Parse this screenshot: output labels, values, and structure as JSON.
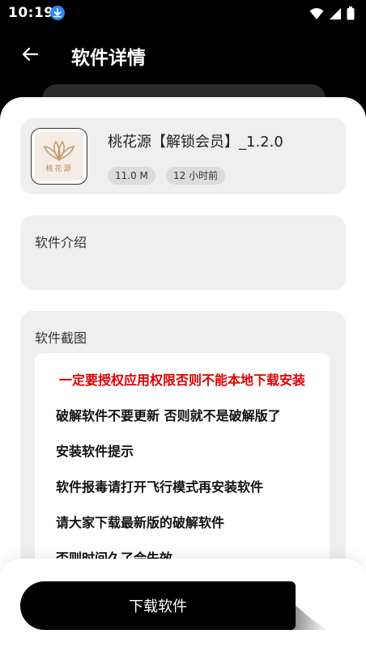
{
  "status": {
    "time": "10:19"
  },
  "header": {
    "title": "软件详情"
  },
  "app": {
    "name": "桃花源【解锁会员】_1.2.0",
    "icon_text": "桃花源",
    "size": "11.0 M",
    "updated": "12 小时前"
  },
  "intro": {
    "title": "软件介绍"
  },
  "screenshots": {
    "title": "软件截图",
    "lines": [
      "一定要授权应用权限否则不能本地下载安装",
      "破解软件不要更新 否则就不是破解版了",
      "安装软件提示",
      "软件报毒请打开飞行模式再安装软件",
      "请大家下载最新版的破解软件",
      "否则时间久了会失效"
    ]
  },
  "footer": {
    "download_label": "下载软件"
  },
  "colors": {
    "accent_blue": "#2f86ff",
    "warning_red": "#e00000"
  }
}
